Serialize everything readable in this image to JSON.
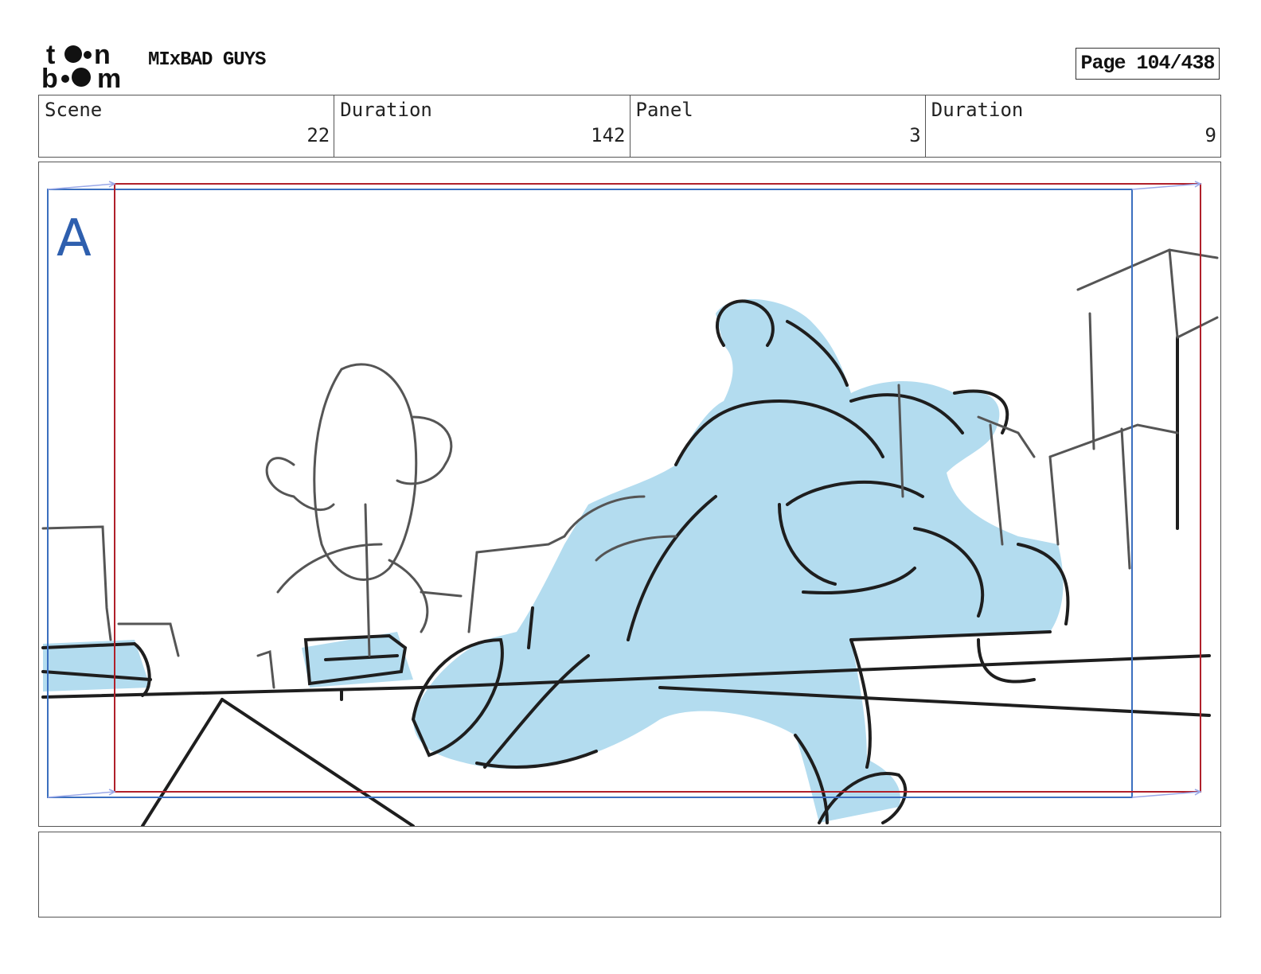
{
  "header": {
    "logo_text": "toon boom",
    "project_title": "MIxBAD GUYS",
    "page_indicator": "Page 104/438"
  },
  "info_bar": {
    "scene_label": "Scene",
    "scene_value": "22",
    "scene_duration_label": "Duration",
    "scene_duration_value": "142",
    "panel_label": "Panel",
    "panel_value": "3",
    "panel_duration_label": "Duration",
    "panel_duration_value": "9"
  },
  "panel": {
    "layer_marker": "A",
    "colors": {
      "camera_frame_blue": "#3b6fbf",
      "safe_frame_red": "#b0202a",
      "fill_blue": "#b3dcef",
      "line_dark": "#1e1e1e"
    }
  },
  "notes": {
    "text": ""
  }
}
